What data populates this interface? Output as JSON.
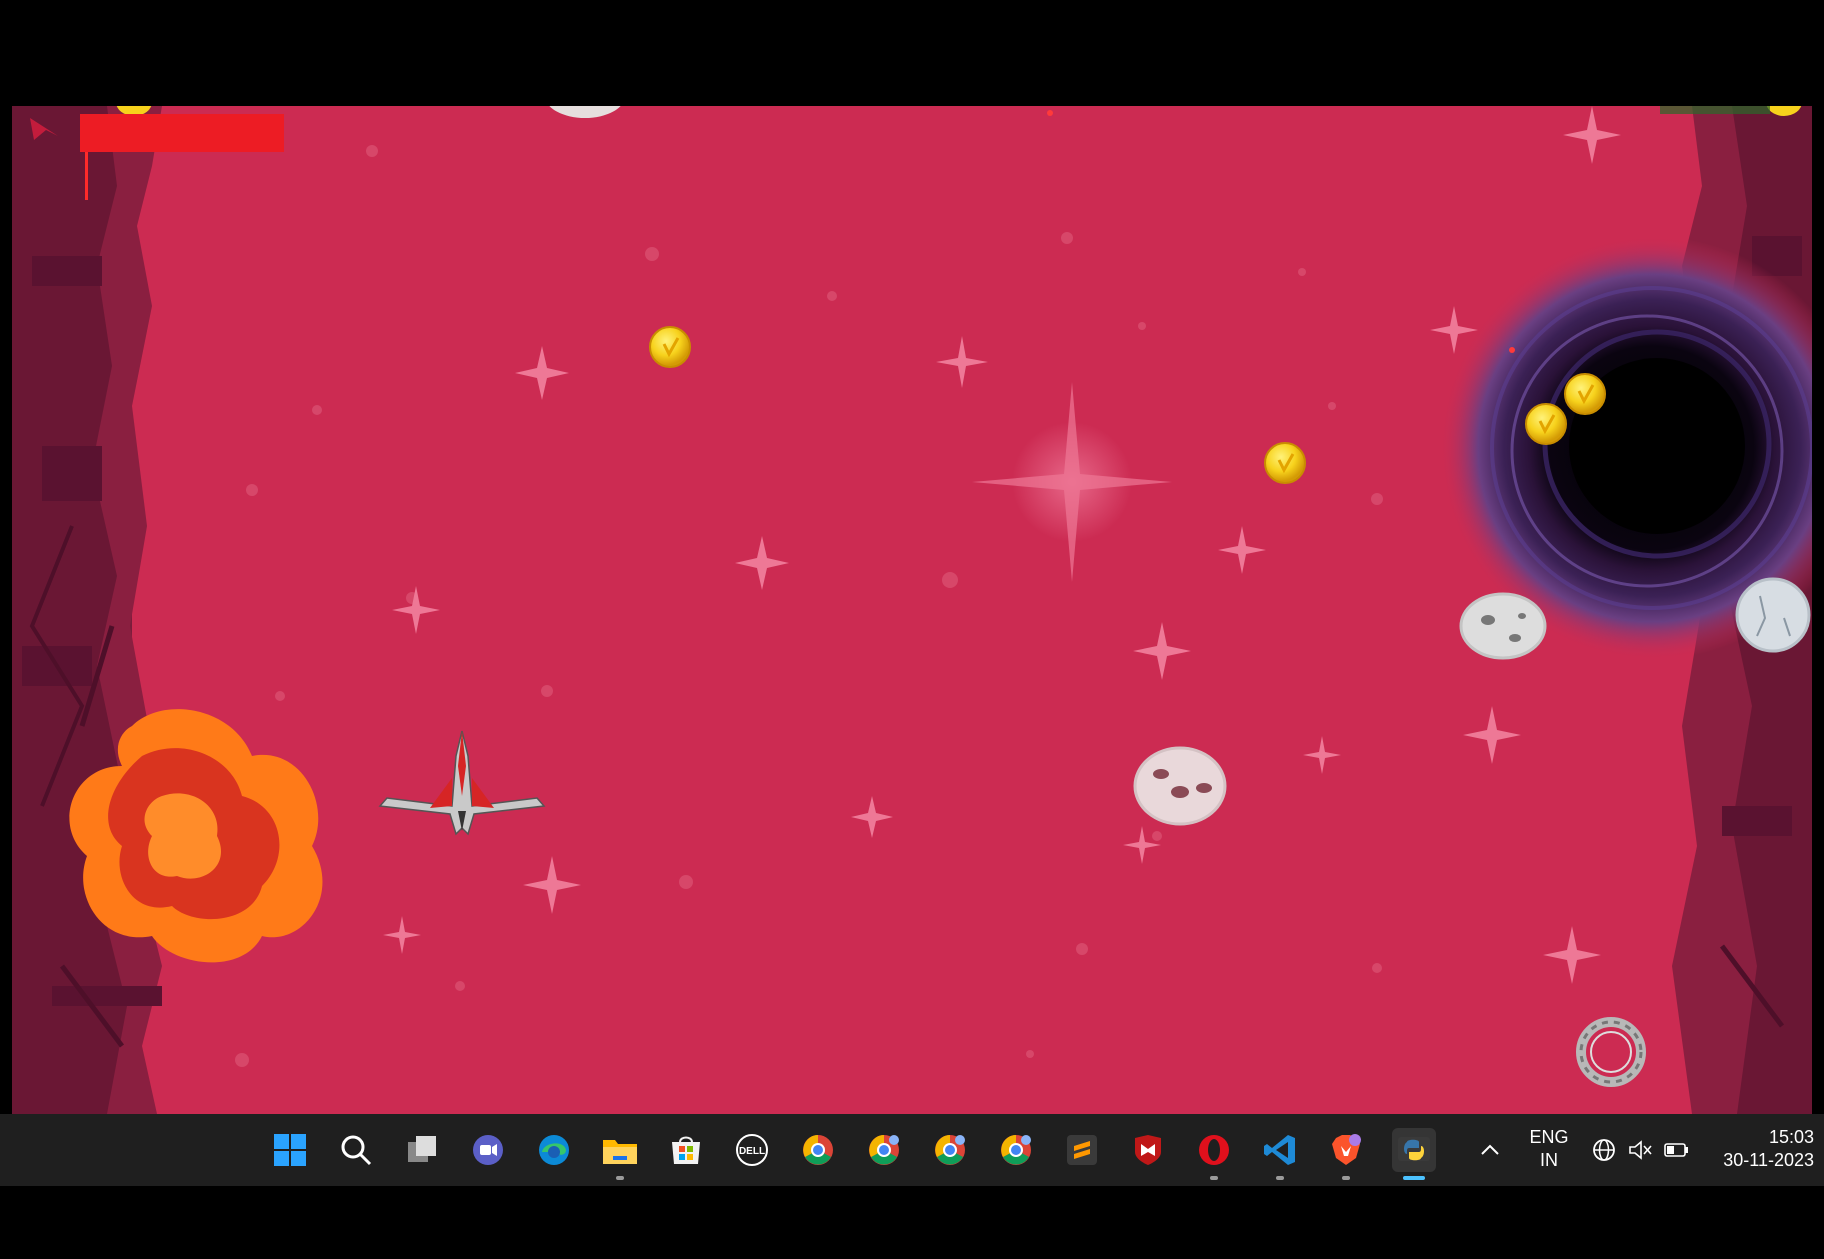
{
  "game": {
    "health_fraction": 1.0,
    "coins": [
      {
        "name": "coin-1"
      },
      {
        "name": "coin-2"
      },
      {
        "name": "coin-3"
      },
      {
        "name": "coin-4"
      }
    ]
  },
  "taskbar": {
    "icons": [
      {
        "name": "start-icon"
      },
      {
        "name": "search-icon"
      },
      {
        "name": "task-view-icon"
      },
      {
        "name": "teams-chat-icon"
      },
      {
        "name": "edge-icon"
      },
      {
        "name": "file-explorer-icon",
        "open": true
      },
      {
        "name": "microsoft-store-icon"
      },
      {
        "name": "dell-icon",
        "label": "DELL"
      },
      {
        "name": "chrome-icon"
      },
      {
        "name": "chrome-profile-icon"
      },
      {
        "name": "chrome-profile-icon"
      },
      {
        "name": "chrome-profile-icon"
      },
      {
        "name": "sublime-text-icon"
      },
      {
        "name": "mcafee-icon"
      },
      {
        "name": "opera-icon",
        "open": true
      },
      {
        "name": "vscode-icon",
        "open": true
      },
      {
        "name": "brave-icon",
        "open": true
      },
      {
        "name": "python-icon",
        "open": true,
        "active": true
      }
    ],
    "language": "ENG",
    "region": "IN",
    "time": "15:03",
    "date": "30-11-2023"
  }
}
